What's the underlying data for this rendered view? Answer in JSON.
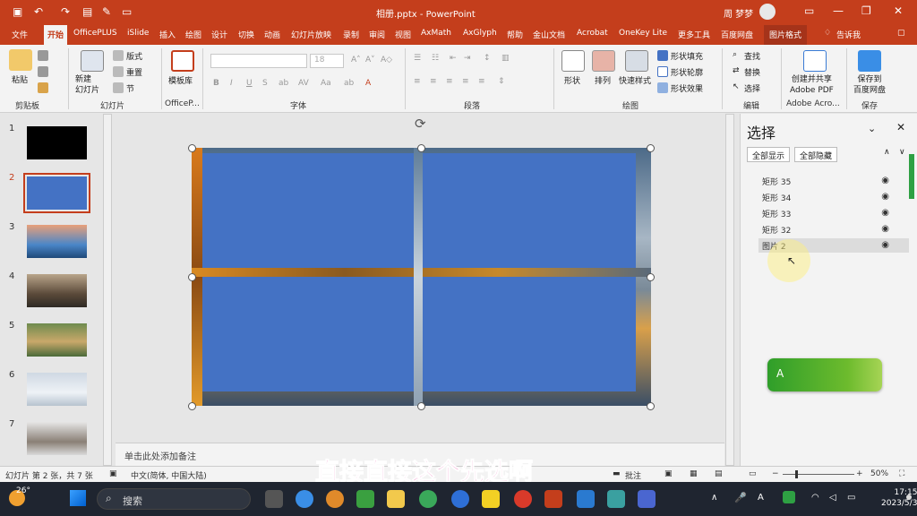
{
  "titlebar": {
    "title": "相册.pptx  -  PowerPoint",
    "user": "周 梦梦"
  },
  "tabs": [
    "文件",
    "开始",
    "OfficePLUS",
    "iSlide",
    "插入",
    "绘图",
    "设计",
    "切换",
    "动画",
    "幻灯片放映",
    "录制",
    "审阅",
    "视图",
    "AxMath",
    "AxGlyph",
    "帮助",
    "金山文档",
    "Acrobat",
    "OneKey Lite",
    "更多工具",
    "百度网盘",
    "图片格式",
    "告诉我"
  ],
  "ribbon": {
    "groups": [
      "剪贴板",
      "幻灯片",
      "OfficeP...",
      "字体",
      "段落",
      "绘图",
      "编辑",
      "Adobe Acro...",
      "保存"
    ],
    "paste": "粘贴",
    "new_slide": "新建\n幻灯片",
    "layout": "版式",
    "reset": "重置",
    "section": "节",
    "template": "模板库",
    "font_size": "18",
    "shapes": "形状",
    "arrange": "排列",
    "quick_styles": "快速样式",
    "shape_fill": "形状填充",
    "shape_outline": "形状轮廓",
    "shape_effect": "形状效果",
    "find": "查找",
    "replace": "替换",
    "select": "选择",
    "adobe": "创建并共享\nAdobe PDF",
    "baidu": "保存到\n百度网盘"
  },
  "slides": [
    1,
    2,
    3,
    4,
    5,
    6,
    7
  ],
  "notes_placeholder": "单击此处添加备注",
  "selection_pane": {
    "title": "选择",
    "show_all": "全部显示",
    "hide_all": "全部隐藏",
    "items": [
      "矩形 35",
      "矩形 34",
      "矩形 33",
      "矩形 32",
      "图片 2"
    ],
    "widget_text": "A"
  },
  "status": {
    "slide_info": "幻灯片 第 2 张，共 7 张",
    "language": "中文(简体, 中国大陆)",
    "comments": "批注",
    "zoom": "50%"
  },
  "subtitle": "直接直接这个先选啊",
  "taskbar": {
    "temp": "26°",
    "search": "搜索",
    "time": "17:15",
    "date": "2023/5/3"
  }
}
